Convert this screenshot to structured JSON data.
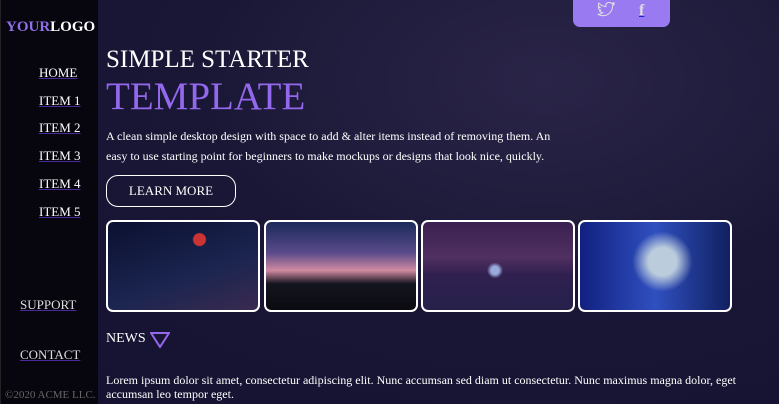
{
  "logo": {
    "part1": "YOUR",
    "part2": "LOGO"
  },
  "nav": [
    "HOME",
    "ITEM 1",
    "ITEM 2",
    "ITEM 3",
    "ITEM 4",
    "ITEM 5"
  ],
  "support": "SUPPORT",
  "contact": "CONTACT",
  "copyright": "©2020 ACME LLC.",
  "social": {
    "twitter": "twitter-icon",
    "facebook": "f"
  },
  "hero": {
    "line1": "SIMPLE STARTER",
    "line2": "TEMPLATE",
    "description": "A clean simple desktop design with space to add & alter items instead of removing them. An easy to use starting point for beginners to make mockups or designs that look nice, quickly.",
    "button": "LEARN MORE"
  },
  "news": {
    "title": "NEWS",
    "body": "Lorem ipsum dolor sit amet, consectetur adipiscing elit. Nunc accumsan sed diam ut consectetur. Nunc maximus magna dolor, eget accumsan leo tempor eget."
  },
  "colors": {
    "accent": "#9368ec",
    "sidebar": "#07060f"
  }
}
